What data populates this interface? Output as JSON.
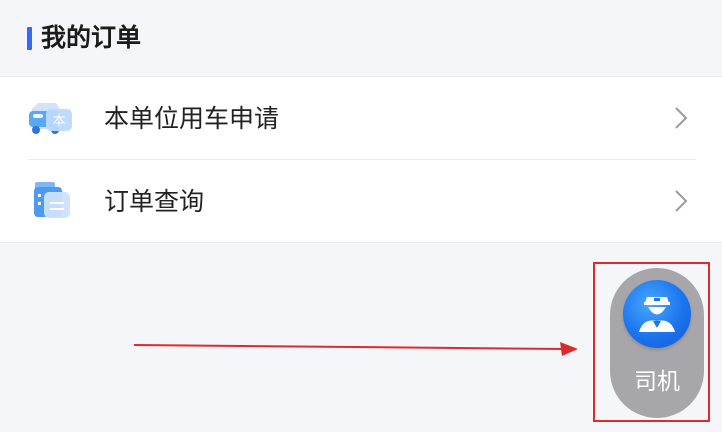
{
  "section": {
    "title": "我的订单"
  },
  "menu": {
    "items": [
      {
        "label": "本单位用车申请",
        "icon": "car-application-icon"
      },
      {
        "label": "订单查询",
        "icon": "order-list-icon"
      }
    ]
  },
  "driver_button": {
    "label": "司机",
    "icon": "driver-icon"
  },
  "colors": {
    "accent": "#3b67f2",
    "annotation": "#e02a2a",
    "fab_background": "#a6a6ab",
    "avatar_blue": "#1b74ee"
  }
}
